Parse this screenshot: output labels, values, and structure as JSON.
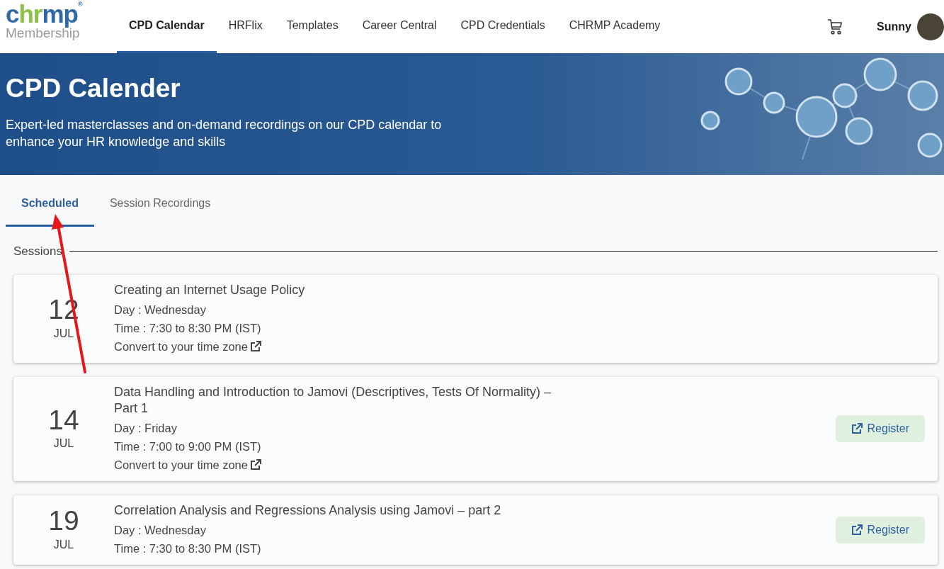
{
  "header": {
    "logo": {
      "word": "chrmp",
      "mark": "®",
      "subtitle": "Membership"
    },
    "nav": [
      {
        "label": "CPD Calendar",
        "selected": true
      },
      {
        "label": "HRFlix",
        "selected": false
      },
      {
        "label": "Templates",
        "selected": false
      },
      {
        "label": "Career Central",
        "selected": false
      },
      {
        "label": "CPD Credentials",
        "selected": false
      },
      {
        "label": "CHRMP Academy",
        "selected": false
      }
    ],
    "user": "Sunny"
  },
  "banner": {
    "title": "CPD Calender",
    "subtitle": "Expert-led masterclasses and on-demand recordings on our CPD calendar to enhance your HR knowledge and skills"
  },
  "tabs": [
    {
      "label": "Scheduled",
      "selected": true
    },
    {
      "label": "Session Recordings",
      "selected": false
    }
  ],
  "section_title": "Sessions",
  "sessions": [
    {
      "day_num": "12",
      "month": "JUL",
      "title": "Creating an Internet Usage Policy",
      "day": "Day : Wednesday",
      "time": "Time : 7:30 to 8:30 PM (IST)",
      "convert": "Convert to your time zone"
    },
    {
      "day_num": "14",
      "month": "JUL",
      "title": "Data Handling and Introduction to Jamovi (Descriptives, Tests Of Normality) – Part 1",
      "day": "Day : Friday",
      "time": "Time : 7:00 to 9:00 PM (IST)",
      "convert": "Convert to your time zone",
      "register": "Register"
    },
    {
      "day_num": "19",
      "month": "JUL",
      "title": "Correlation Analysis and Regressions Analysis using Jamovi – part 2",
      "day": "Day : Wednesday",
      "time": "Time : 7:30 to 8:30 PM (IST)",
      "register": "Register"
    }
  ],
  "annotation": {
    "kind": "arrow"
  }
}
